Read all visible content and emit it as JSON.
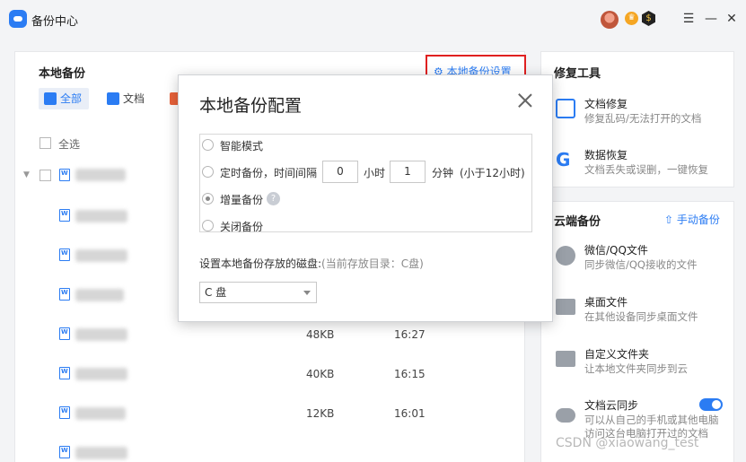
{
  "app": {
    "title": "备份中心"
  },
  "header": {
    "menu_icon": "hamburger-icon",
    "min_icon": "minimize-icon",
    "close_icon": "close-icon"
  },
  "main": {
    "title": "本地备份",
    "settings_link": "本地备份设置",
    "tabs": [
      {
        "label": "全部",
        "active": true
      },
      {
        "label": "文档",
        "active": false
      }
    ],
    "select_all": "全选",
    "rows": [
      {
        "size": "",
        "time": ""
      },
      {
        "size": "",
        "time": ""
      },
      {
        "size": "",
        "time": ""
      },
      {
        "size": "",
        "time": ""
      },
      {
        "size": "48KB",
        "time": "16:27"
      },
      {
        "size": "40KB",
        "time": "16:15"
      },
      {
        "size": "12KB",
        "time": "16:01"
      }
    ]
  },
  "repair": {
    "title": "修复工具",
    "items": [
      {
        "name": "文档修复",
        "desc": "修复乱码/无法打开的文档",
        "icon": "document-repair-icon"
      },
      {
        "name": "数据恢复",
        "desc": "文档丢失或误删，一键恢复",
        "icon": "recover-g-icon"
      }
    ]
  },
  "cloud": {
    "title": "云端备份",
    "manual_label": "手动备份",
    "items": [
      {
        "name": "微信/QQ文件",
        "desc": "同步微信/QQ接收的文件",
        "icon": "chat-icon"
      },
      {
        "name": "桌面文件",
        "desc": "在其他设备同步桌面文件",
        "icon": "desktop-icon"
      },
      {
        "name": "自定义文件夹",
        "desc": "让本地文件夹同步到云",
        "icon": "folder-icon"
      },
      {
        "name": "文档云同步",
        "desc": "可以从自己的手机或其他电脑",
        "desc2": "访问这台电脑打开过的文档",
        "icon": "cloud-upload-icon"
      }
    ],
    "sync_enabled": true
  },
  "dialog": {
    "title": "本地备份配置",
    "options": {
      "smart": "智能模式",
      "timed_prefix": "定时备份，时间间隔",
      "hours_value": "0",
      "hours_unit": "小时",
      "minutes_value": "1",
      "minutes_unit": "分钟",
      "timed_hint": "(小于12小时)",
      "incremental": "增量备份",
      "off": "关闭备份"
    },
    "selected_option": "incremental",
    "disk_label": "设置本地备份存放的磁盘:",
    "disk_hint": "(当前存放目录：C盘)",
    "disk_value": "C 盘"
  },
  "watermark": "CSDN @xiaowang_test"
}
